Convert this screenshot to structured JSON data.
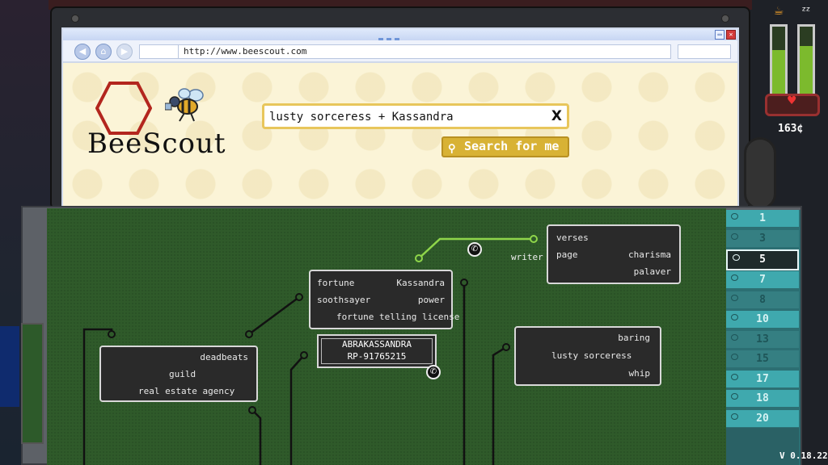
{
  "browser": {
    "url": "http://www.beescout.com",
    "logo_text": "BeeScout",
    "search_query": "lusty sorceress + Kassandra",
    "search_clear": "X",
    "search_button": "Search for me",
    "nav_icons": [
      "back-arrow-icon",
      "home-icon",
      "forward-arrow-icon"
    ]
  },
  "hud": {
    "credits": "163¢",
    "energy_meter": 0.65,
    "sleep_meter": 0.72,
    "version": "V 0.18.22"
  },
  "board": {
    "note_top": {
      "words": [
        "fortune",
        "Kassandra",
        "soothsayer",
        "power",
        "fortune telling license"
      ]
    },
    "note_right_top": {
      "words": [
        "verses",
        "page",
        "charisma",
        "palaver"
      ]
    },
    "note_left": {
      "words": [
        "deadbeats",
        "guild",
        "real estate agency"
      ]
    },
    "note_right": {
      "words": [
        "baring",
        "lusty sorceress",
        "whip"
      ]
    },
    "phone_card": {
      "name": "ABRAKASSANDRA",
      "number": "RP-91765215"
    },
    "wire_label": "writer"
  },
  "tabs": [
    {
      "label": "1",
      "state": "normal"
    },
    {
      "label": "3",
      "state": "dim"
    },
    {
      "label": "5",
      "state": "active"
    },
    {
      "label": "7",
      "state": "normal"
    },
    {
      "label": "8",
      "state": "dim"
    },
    {
      "label": "10",
      "state": "normal"
    },
    {
      "label": "13",
      "state": "dim"
    },
    {
      "label": "15",
      "state": "dim"
    },
    {
      "label": "17",
      "state": "normal"
    },
    {
      "label": "18",
      "state": "normal"
    },
    {
      "label": "20",
      "state": "normal"
    }
  ],
  "colors": {
    "accent": "#d8b235",
    "board": "#2f5a2a",
    "wire_active": "#8fd64a",
    "tab": "#3fa9ae"
  }
}
